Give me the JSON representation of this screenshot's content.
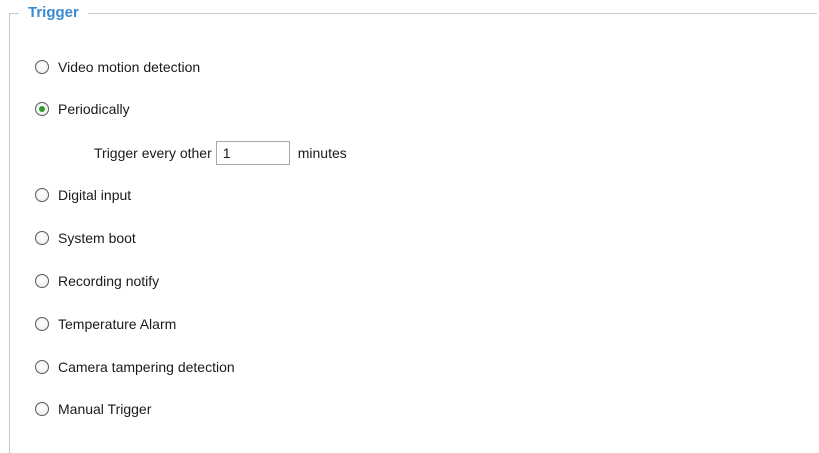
{
  "section": {
    "legend": "Trigger"
  },
  "triggers": [
    {
      "label": "Video motion detection",
      "selected": false
    },
    {
      "label": "Periodically",
      "selected": true
    },
    {
      "label": "Digital input",
      "selected": false
    },
    {
      "label": "System boot",
      "selected": false
    },
    {
      "label": "Recording notify",
      "selected": false
    },
    {
      "label": "Temperature Alarm",
      "selected": false
    },
    {
      "label": "Camera tampering detection",
      "selected": false
    },
    {
      "label": "Manual Trigger",
      "selected": false
    }
  ],
  "periodic": {
    "prefix": "Trigger every other",
    "value": "1",
    "unit": "minutes"
  },
  "colors": {
    "legend": "#3a8ad2",
    "radio_selected": "#2e9a2e"
  }
}
